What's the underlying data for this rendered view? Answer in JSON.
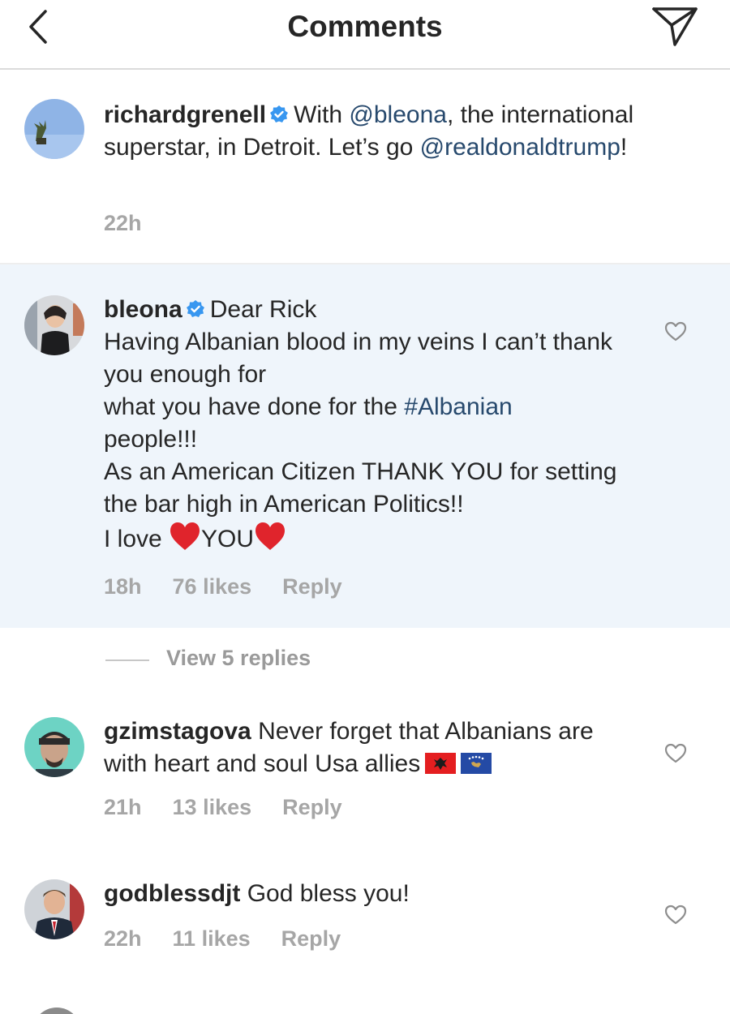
{
  "header": {
    "title": "Comments",
    "back_icon": "chevron-left-icon",
    "send_icon": "paper-plane-icon"
  },
  "colors": {
    "text": "#262626",
    "link": "#27496d",
    "meta": "#a6a6a6",
    "verified": "#3897f0",
    "highlight_bg": "#eff5fb",
    "divider": "#dbdbdb",
    "heart": "#e0242c"
  },
  "caption": {
    "username": "richardgrenell",
    "verified": true,
    "text_before": "With ",
    "mention1": "@bleona",
    "text_middle": ", the international superstar, in Detroit. Let’s go ",
    "mention2": "@realdonaldtrump",
    "text_after": "!",
    "time": "22h"
  },
  "comments": [
    {
      "username": "bleona",
      "verified": true,
      "line1": "Dear Rick",
      "line2": "Having Albanian blood in my veins I can’t thank you enough for",
      "line3_before": "what you have done for the ",
      "hashtag": "#Albanian",
      "line3_after": " people!!!",
      "line4": "As an American Citizen THANK YOU for setting the bar high in American Politics!!",
      "line5_before": "I love ",
      "line5_middle": "YOU",
      "time": "18h",
      "likes": "76 likes",
      "reply_label": "Reply",
      "view_replies": "View 5 replies"
    },
    {
      "username": "gzimstagova",
      "text": "Never forget that Albanians are with heart and soul Usa allies",
      "emojis": [
        "albania-flag-icon",
        "kosovo-flag-icon"
      ],
      "time": "21h",
      "likes": "13 likes",
      "reply_label": "Reply"
    },
    {
      "username": "godblessdjt",
      "text": "God bless you!",
      "time": "22h",
      "likes": "11 likes",
      "reply_label": "Reply"
    }
  ]
}
